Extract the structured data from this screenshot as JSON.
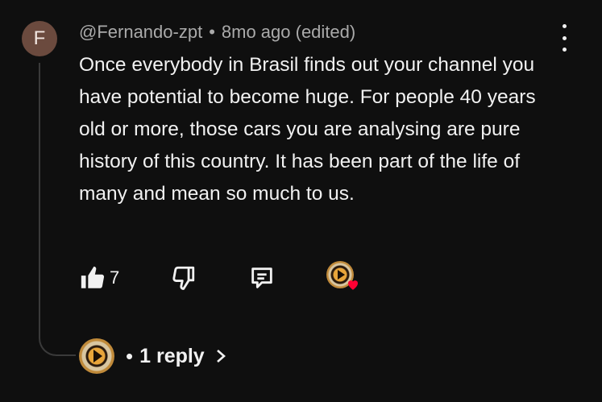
{
  "comment": {
    "avatar_initial": "F",
    "author": "@Fernando-zpt",
    "separator": "•",
    "time": "8mo ago (edited)",
    "text": "Once everybody in Brasil finds out your channel you have potential to become huge. For people 40 years old or more, those cars you are analysing are pure history of this country. It has been part of the life of many and mean so much to us.",
    "like_count": "7"
  },
  "replies": {
    "separator": "•",
    "label": "1 reply"
  },
  "icons": {
    "menu": "more-vert-icon",
    "like": "thumb-up-icon",
    "dislike": "thumb-down-icon",
    "reply": "comment-reply-icon",
    "hearted_by": "creator-heart-icon",
    "expand": "chevron-right-icon"
  },
  "colors": {
    "background": "#0f0f0f",
    "text": "#f1f1f1",
    "meta": "#aaaaaa",
    "avatar": "#6b4a3e",
    "heart": "#ff0033"
  }
}
